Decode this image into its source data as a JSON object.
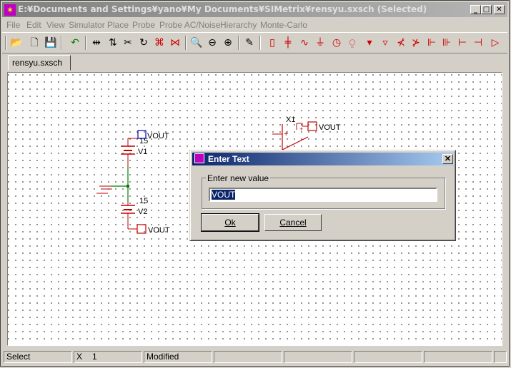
{
  "window": {
    "title": "E:¥Documents and Settings¥yano¥My Documents¥SIMetrix¥rensyu.sxsch (Selected)",
    "minimize": "_",
    "maximize": "□",
    "close": "✕"
  },
  "menu": {
    "items": [
      "File",
      "Edit",
      "View",
      "Simulator",
      "Place",
      "Probe",
      "Probe AC/Noise",
      "Hierarchy",
      "Monte-Carlo"
    ]
  },
  "toolbar": {
    "icons": [
      "open-folder-icon",
      "new-file-icon",
      "save-icon",
      "undo-icon",
      "mirror-icon",
      "flip-icon",
      "cut-icon",
      "rotate-icon",
      "delete-wire-icon",
      "delete-icon",
      "zoom-full-icon",
      "zoom-out-icon",
      "zoom-in-icon",
      "draw-wire-icon",
      "resistor-icon",
      "capacitor-icon",
      "inductor-icon",
      "ground-icon",
      "voltage-source-icon",
      "current-source-icon",
      "diode-icon",
      "zener-icon",
      "npn-icon",
      "pnp-icon",
      "nmos-icon",
      "pmos-icon",
      "njfet-icon",
      "pjfet-icon",
      "opamp-icon"
    ]
  },
  "tab": {
    "label": "rensyu.sxsch"
  },
  "schematic": {
    "v1_value": "15",
    "v1_name": "V1",
    "v2_value": "15",
    "v2_name": "V2",
    "vout_label_1": "VOUT",
    "vout_label_2": "VOUT",
    "vout_label_3": "VOUT",
    "opamp_name": "X1",
    "opamp_plus": "+",
    "opamp_minus": "−"
  },
  "dialog": {
    "title": "Enter Text",
    "close": "✕",
    "group_label": "Enter new value",
    "input_value": "VOUT",
    "ok_label": "Ok",
    "cancel_label": "Cancel"
  },
  "status": {
    "mode": "Select",
    "x_label": "X",
    "x_value": "1",
    "state": "Modified"
  }
}
